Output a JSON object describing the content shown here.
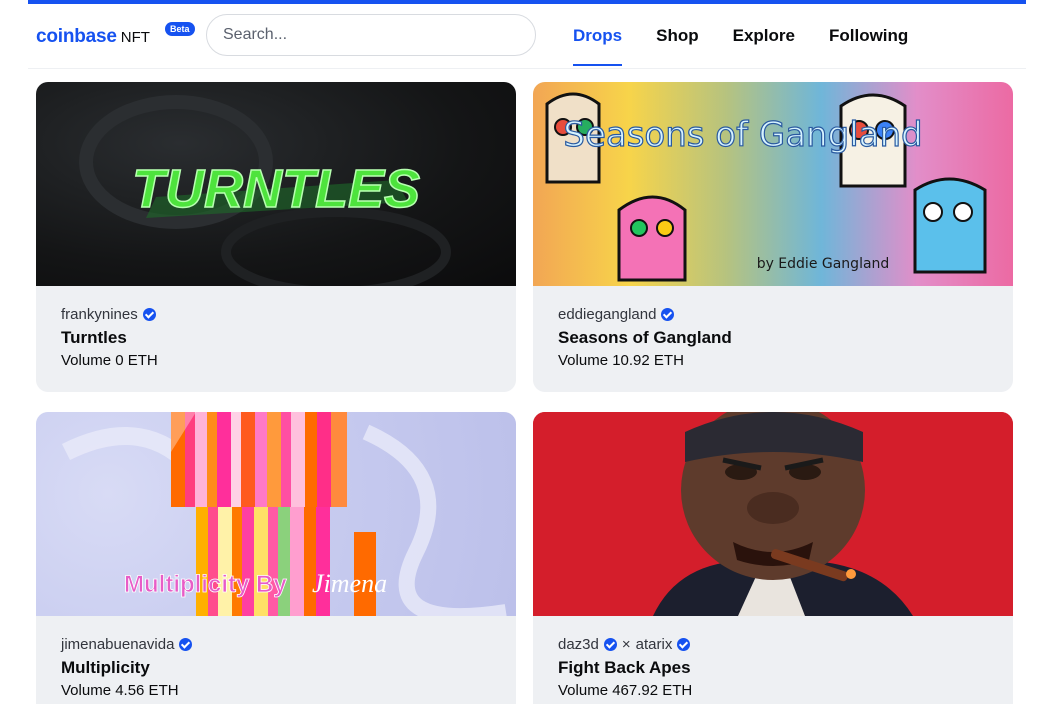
{
  "header": {
    "logo_word": "coinbase",
    "logo_suffix": "NFT",
    "beta_badge": "Beta",
    "search_placeholder": "Search...",
    "nav": [
      {
        "label": "Drops",
        "active": true
      },
      {
        "label": "Shop",
        "active": false
      },
      {
        "label": "Explore",
        "active": false
      },
      {
        "label": "Following",
        "active": false
      }
    ]
  },
  "cards": [
    {
      "creator": "frankynines",
      "collab": "",
      "title": "Turntles",
      "volume": "Volume 0 ETH",
      "art_text": "TURNTLES"
    },
    {
      "creator": "eddiegangland",
      "collab": "",
      "title": "Seasons of Gangland",
      "volume": "Volume 10.92 ETH",
      "art_text": "Seasons of Gangland",
      "art_subtext": "by Eddie Gangland"
    },
    {
      "creator": "jimenabuenavida",
      "collab": "",
      "title": "Multiplicity",
      "volume": "Volume 4.56 ETH",
      "art_text": "Multiplicity By",
      "art_subtext": "Jimena"
    },
    {
      "creator": "daz3d",
      "collab": "atarix",
      "title": "Fight Back Apes",
      "volume": "Volume 467.92 ETH"
    }
  ],
  "colors": {
    "brand": "#1652f0",
    "card_bg": "#eef0f3"
  }
}
